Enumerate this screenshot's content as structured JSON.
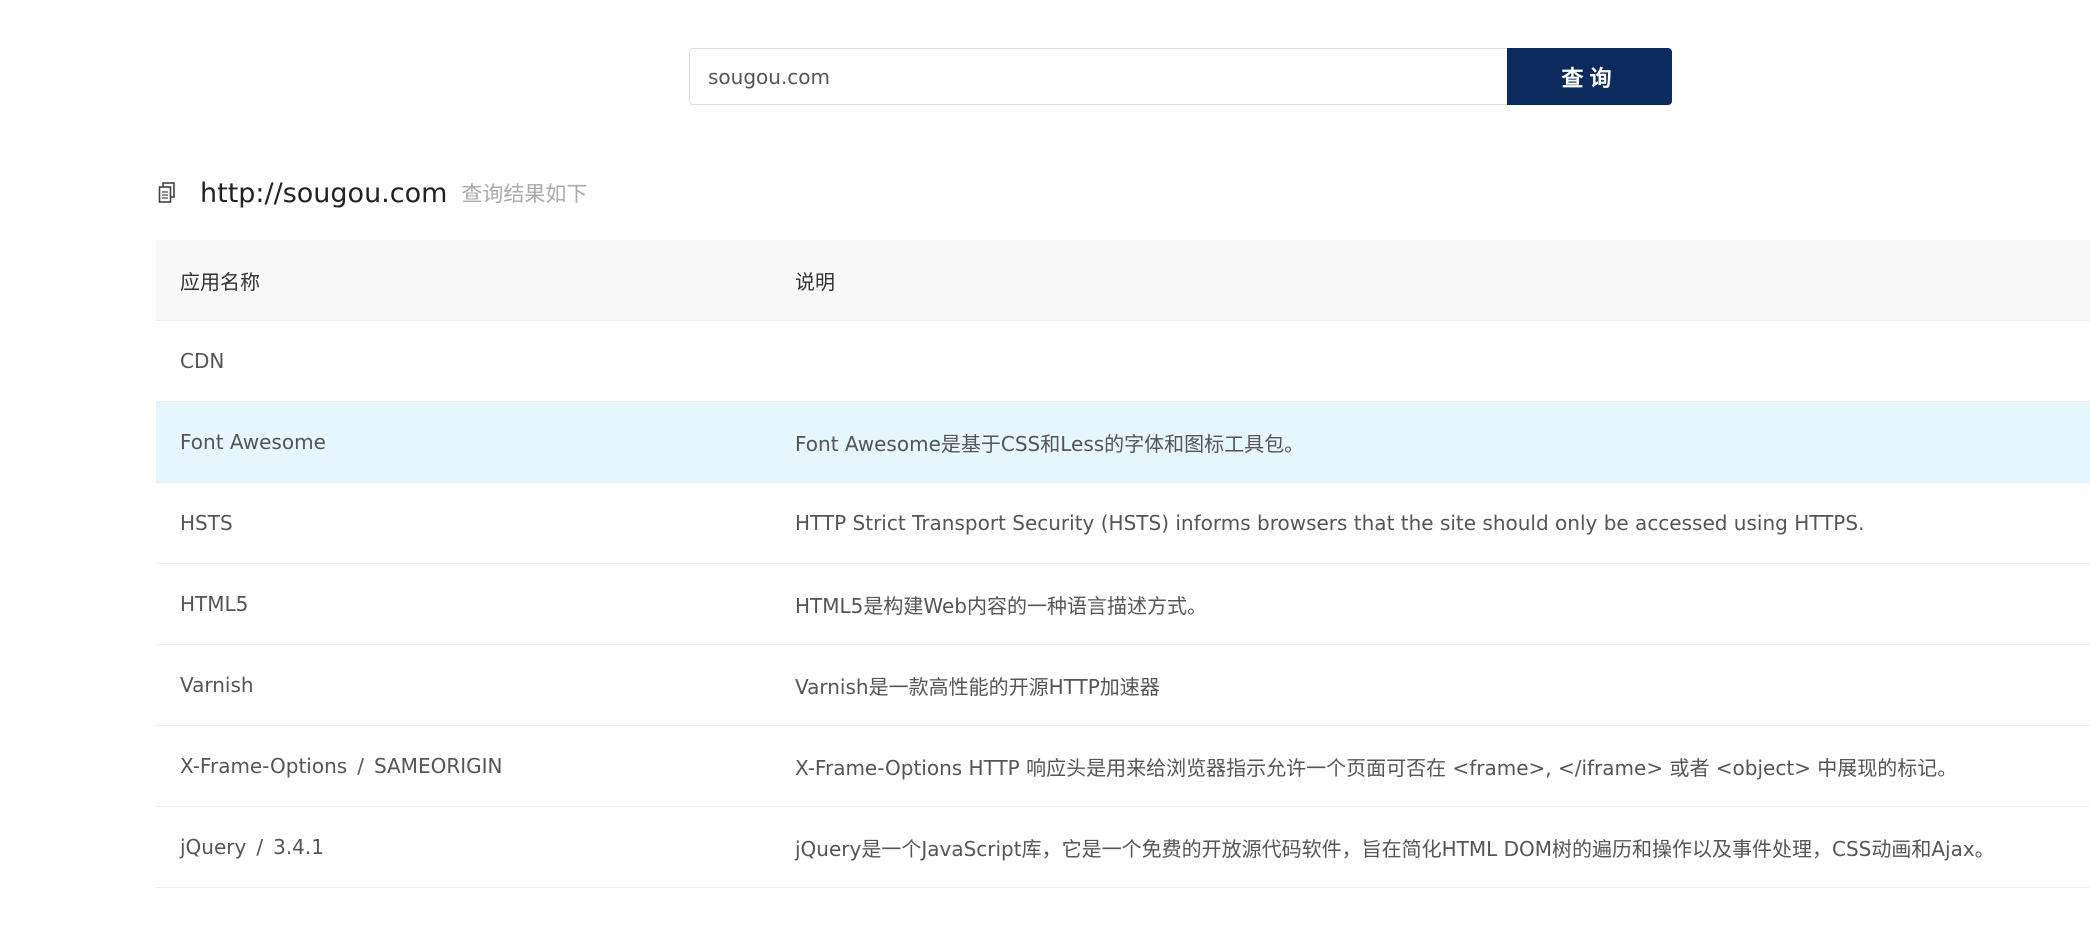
{
  "search": {
    "value": "sougou.com",
    "button_label": "查询"
  },
  "result": {
    "url": "http://sougou.com",
    "hint": "查询结果如下",
    "copy_icon": "copy-icon"
  },
  "table": {
    "headers": [
      "应用名称",
      "说明"
    ],
    "rows": [
      {
        "name": "CDN",
        "version": "",
        "desc": ""
      },
      {
        "name": "Font Awesome",
        "version": "",
        "desc": "Font Awesome是基于CSS和Less的字体和图标工具包。"
      },
      {
        "name": "HSTS",
        "version": "",
        "desc": "HTTP Strict Transport Security (HSTS) informs browsers that the site should only be accessed using HTTPS."
      },
      {
        "name": "HTML5",
        "version": "",
        "desc": "HTML5是构建Web内容的一种语言描述方式。"
      },
      {
        "name": "Varnish",
        "version": "",
        "desc": "Varnish是一款高性能的开源HTTP加速器"
      },
      {
        "name": "X-Frame-Options",
        "version": "SAMEORIGIN",
        "desc": "X-Frame-Options HTTP 响应头是用来给浏览器指示允许一个页面可否在 <frame>, </iframe> 或者 <object> 中展现的标记。"
      },
      {
        "name": "jQuery",
        "version": "3.4.1",
        "desc": "jQuery是一个JavaScript库，它是一个免费的开放源代码软件，旨在简化HTML DOM树的遍历和操作以及事件处理，CSS动画和Ajax。"
      }
    ],
    "highlighted_row": 1
  },
  "colors": {
    "button_bg": "#0b2a5e",
    "highlight_row_bg": "#e6f6fd",
    "header_bg": "#f8f8f8"
  }
}
